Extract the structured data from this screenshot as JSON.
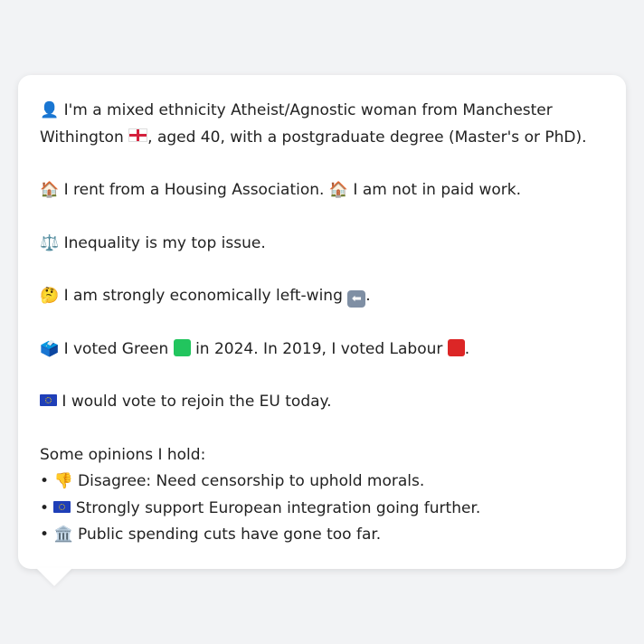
{
  "profile": {
    "line1a": "I'm a mixed ethnicity Atheist/Agnostic woman from Manchester",
    "line1b_pre": "Withington",
    "line1b_post": ", aged 40, with a postgraduate degree (Master's or PhD).",
    "icon_person": "👤",
    "icon_flag": "england-flag-icon"
  },
  "housing": {
    "icon": "🏠",
    "rent_text": "I rent from a Housing Association.",
    "work_text": "I am not in paid work."
  },
  "issue": {
    "icon": "⚖️",
    "text": "Inequality is my top issue."
  },
  "economics": {
    "icon": "🤔",
    "text": "I am strongly economically left-wing",
    "arrow": "⬅",
    "period": "."
  },
  "votes": {
    "icon": "🗳️",
    "text_2024_pre": "I voted Green",
    "text_2024_post": "in 2024. In 2019, I voted Labour",
    "period": ".",
    "green_color": "#22c55e",
    "red_color": "#dc2626"
  },
  "eu": {
    "text": "I would vote to rejoin the EU today."
  },
  "opinions": {
    "header": "Some opinions I hold:",
    "bullet": "•",
    "items": [
      {
        "icon": "👎",
        "text": "Disagree: Need censorship to uphold morals."
      },
      {
        "icon": "eu-flag-icon",
        "text": "Strongly support European integration going further."
      },
      {
        "icon": "🏛️",
        "text": "Public spending cuts have gone too far."
      }
    ]
  }
}
